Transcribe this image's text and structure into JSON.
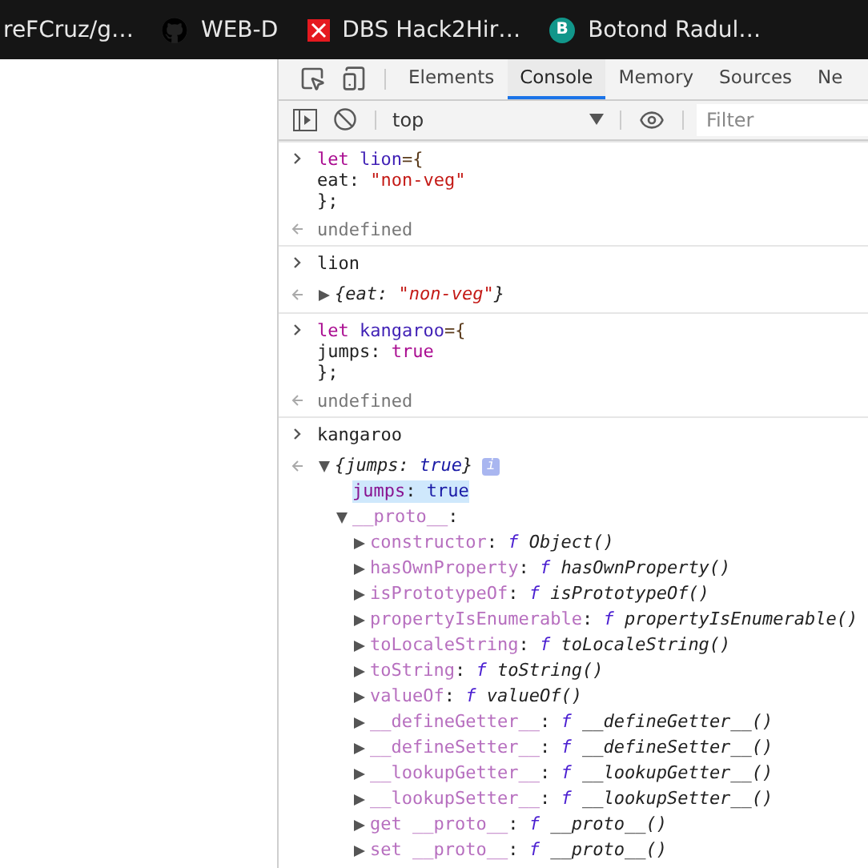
{
  "bookmarks": [
    {
      "kind": "plain",
      "label": "reFCruz/g…"
    },
    {
      "kind": "github",
      "label": "WEB-D"
    },
    {
      "kind": "redx",
      "label": "DBS Hack2Hir…"
    },
    {
      "kind": "letter",
      "letter": "B",
      "label": "Botond Radul…"
    }
  ],
  "tabs": [
    {
      "label": "Elements",
      "selected": false
    },
    {
      "label": "Console",
      "selected": true
    },
    {
      "label": "Memory",
      "selected": false
    },
    {
      "label": "Sources",
      "selected": false
    },
    {
      "label": "Ne",
      "selected": false
    }
  ],
  "console_toolbar": {
    "context": "top",
    "filter_placeholder": "Filter"
  },
  "entries": [
    {
      "kind": "input",
      "lines": [
        [
          {
            "kind": "kw",
            "text": "let "
          },
          {
            "kind": "name",
            "text": "lion"
          },
          {
            "kind": "punct",
            "text": "={"
          }
        ],
        [
          {
            "kind": "plain",
            "text": "eat: "
          },
          {
            "kind": "str",
            "text": "\"non-veg\""
          }
        ],
        [
          {
            "kind": "plain",
            "text": "};"
          }
        ]
      ]
    },
    {
      "kind": "output",
      "lines": [
        [
          {
            "kind": "undef",
            "text": "undefined"
          }
        ]
      ]
    },
    {
      "kind": "input",
      "lines": [
        [
          {
            "kind": "plain",
            "text": "lion"
          }
        ]
      ]
    },
    {
      "kind": "tree",
      "node": {
        "preview": true,
        "expanded": false,
        "selected": false,
        "tokens": [
          {
            "kind": "plain",
            "text": "{eat: "
          },
          {
            "kind": "str",
            "text": "\"non-veg\""
          },
          {
            "kind": "plain",
            "text": "}"
          }
        ]
      }
    },
    {
      "kind": "input",
      "lines": [
        [
          {
            "kind": "kw",
            "text": "let "
          },
          {
            "kind": "name",
            "text": "kangaroo"
          },
          {
            "kind": "punct",
            "text": "={"
          }
        ],
        [
          {
            "kind": "plain",
            "text": "jumps: "
          },
          {
            "kind": "kw",
            "text": "true"
          }
        ],
        [
          {
            "kind": "plain",
            "text": "};"
          }
        ]
      ]
    },
    {
      "kind": "output",
      "lines": [
        [
          {
            "kind": "undef",
            "text": "undefined"
          }
        ]
      ]
    },
    {
      "kind": "input",
      "lines": [
        [
          {
            "kind": "plain",
            "text": "kangaroo"
          }
        ]
      ]
    },
    {
      "kind": "tree",
      "node": {
        "preview": true,
        "expanded": true,
        "selected": false,
        "badge": "i",
        "tokens": [
          {
            "kind": "plain",
            "text": "{jumps: "
          },
          {
            "kind": "pbool",
            "text": "true"
          },
          {
            "kind": "plain",
            "text": "}"
          }
        ],
        "children": [
          {
            "selected": true,
            "tokens": [
              {
                "kind": "pkey",
                "text": "jumps"
              },
              {
                "kind": "plain",
                "text": ": "
              },
              {
                "kind": "pbool",
                "text": "true"
              }
            ]
          },
          {
            "selected": false,
            "expanded": true,
            "tokens": [
              {
                "kind": "dkey",
                "text": "__proto__"
              },
              {
                "kind": "plain",
                "text": ":"
              }
            ],
            "children": [
              {
                "selected": false,
                "expanded": false,
                "tokens": [
                  {
                    "kind": "dkey",
                    "text": "constructor"
                  },
                  {
                    "kind": "plain",
                    "text": ": "
                  },
                  {
                    "kind": "f",
                    "text": "f "
                  },
                  {
                    "kind": "fname",
                    "text": "Object()"
                  }
                ]
              },
              {
                "selected": false,
                "expanded": false,
                "tokens": [
                  {
                    "kind": "dkey",
                    "text": "hasOwnProperty"
                  },
                  {
                    "kind": "plain",
                    "text": ": "
                  },
                  {
                    "kind": "f",
                    "text": "f "
                  },
                  {
                    "kind": "fname",
                    "text": "hasOwnProperty()"
                  }
                ]
              },
              {
                "selected": false,
                "expanded": false,
                "tokens": [
                  {
                    "kind": "dkey",
                    "text": "isPrototypeOf"
                  },
                  {
                    "kind": "plain",
                    "text": ": "
                  },
                  {
                    "kind": "f",
                    "text": "f "
                  },
                  {
                    "kind": "fname",
                    "text": "isPrototypeOf()"
                  }
                ]
              },
              {
                "selected": false,
                "expanded": false,
                "tokens": [
                  {
                    "kind": "dkey",
                    "text": "propertyIsEnumerable"
                  },
                  {
                    "kind": "plain",
                    "text": ": "
                  },
                  {
                    "kind": "f",
                    "text": "f "
                  },
                  {
                    "kind": "fname",
                    "text": "propertyIsEnumerable()"
                  }
                ]
              },
              {
                "selected": false,
                "expanded": false,
                "tokens": [
                  {
                    "kind": "dkey",
                    "text": "toLocaleString"
                  },
                  {
                    "kind": "plain",
                    "text": ": "
                  },
                  {
                    "kind": "f",
                    "text": "f "
                  },
                  {
                    "kind": "fname",
                    "text": "toLocaleString()"
                  }
                ]
              },
              {
                "selected": false,
                "expanded": false,
                "tokens": [
                  {
                    "kind": "dkey",
                    "text": "toString"
                  },
                  {
                    "kind": "plain",
                    "text": ": "
                  },
                  {
                    "kind": "f",
                    "text": "f "
                  },
                  {
                    "kind": "fname",
                    "text": "toString()"
                  }
                ]
              },
              {
                "selected": false,
                "expanded": false,
                "tokens": [
                  {
                    "kind": "dkey",
                    "text": "valueOf"
                  },
                  {
                    "kind": "plain",
                    "text": ": "
                  },
                  {
                    "kind": "f",
                    "text": "f "
                  },
                  {
                    "kind": "fname",
                    "text": "valueOf()"
                  }
                ]
              },
              {
                "selected": false,
                "expanded": false,
                "tokens": [
                  {
                    "kind": "dkey",
                    "text": "__defineGetter__"
                  },
                  {
                    "kind": "plain",
                    "text": ": "
                  },
                  {
                    "kind": "f",
                    "text": "f "
                  },
                  {
                    "kind": "fname",
                    "text": "__defineGetter__()"
                  }
                ]
              },
              {
                "selected": false,
                "expanded": false,
                "tokens": [
                  {
                    "kind": "dkey",
                    "text": "__defineSetter__"
                  },
                  {
                    "kind": "plain",
                    "text": ": "
                  },
                  {
                    "kind": "f",
                    "text": "f "
                  },
                  {
                    "kind": "fname",
                    "text": "__defineSetter__()"
                  }
                ]
              },
              {
                "selected": false,
                "expanded": false,
                "tokens": [
                  {
                    "kind": "dkey",
                    "text": "__lookupGetter__"
                  },
                  {
                    "kind": "plain",
                    "text": ": "
                  },
                  {
                    "kind": "f",
                    "text": "f "
                  },
                  {
                    "kind": "fname",
                    "text": "__lookupGetter__()"
                  }
                ]
              },
              {
                "selected": false,
                "expanded": false,
                "tokens": [
                  {
                    "kind": "dkey",
                    "text": "__lookupSetter__"
                  },
                  {
                    "kind": "plain",
                    "text": ": "
                  },
                  {
                    "kind": "f",
                    "text": "f "
                  },
                  {
                    "kind": "fname",
                    "text": "__lookupSetter__()"
                  }
                ]
              },
              {
                "selected": false,
                "expanded": false,
                "tokens": [
                  {
                    "kind": "dkey",
                    "text": "get __proto__"
                  },
                  {
                    "kind": "plain",
                    "text": ": "
                  },
                  {
                    "kind": "f",
                    "text": "f "
                  },
                  {
                    "kind": "fname",
                    "text": "__proto__()"
                  }
                ]
              },
              {
                "selected": false,
                "expanded": false,
                "tokens": [
                  {
                    "kind": "dkey",
                    "text": "set __proto__"
                  },
                  {
                    "kind": "plain",
                    "text": ": "
                  },
                  {
                    "kind": "f",
                    "text": "f "
                  },
                  {
                    "kind": "fname",
                    "text": "__proto__()"
                  }
                ]
              }
            ]
          }
        ]
      }
    }
  ]
}
